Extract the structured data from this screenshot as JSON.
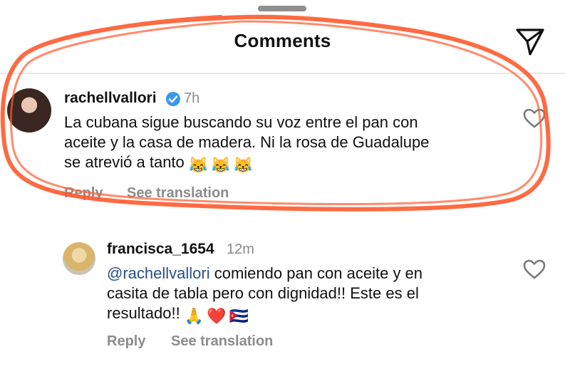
{
  "header": {
    "title": "Comments"
  },
  "comments": [
    {
      "username": "rachellvallori",
      "time": "7h",
      "text": "La cubana sigue buscando su voz entre el pan con aceite y la casa de madera.  Ni la rosa de Guadalupe se atrevió a tanto",
      "line1": "La cubana sigue buscando su voz entre el pan con",
      "line2": "aceite y la casa de madera.  Ni la rosa de Guadalupe",
      "line3": "se atrevió a tanto",
      "emojis": [
        "😹",
        "😹",
        "😹"
      ],
      "reply_label": "Reply",
      "translation_label": "See translation",
      "verified": true
    },
    {
      "username": "francisca_1654",
      "time": "12m",
      "mention": "@rachellvallori",
      "line1_rest": " comiendo pan con aceite y en",
      "line2": "casita de tabla pero con dignidad!! Este es el",
      "line3": "resultado!!",
      "emojis": [
        "🙏",
        "❤️",
        "🇨🇺"
      ],
      "reply_label": "Reply",
      "translation_label": "See translation"
    }
  ],
  "icons": [
    "send-icon",
    "verified-badge-icon",
    "heart-icon"
  ],
  "colors": {
    "mention": "#2b4f86",
    "scribble": "#ff5a2e",
    "verified": "#3897f0",
    "muted": "#8c8c8c"
  }
}
